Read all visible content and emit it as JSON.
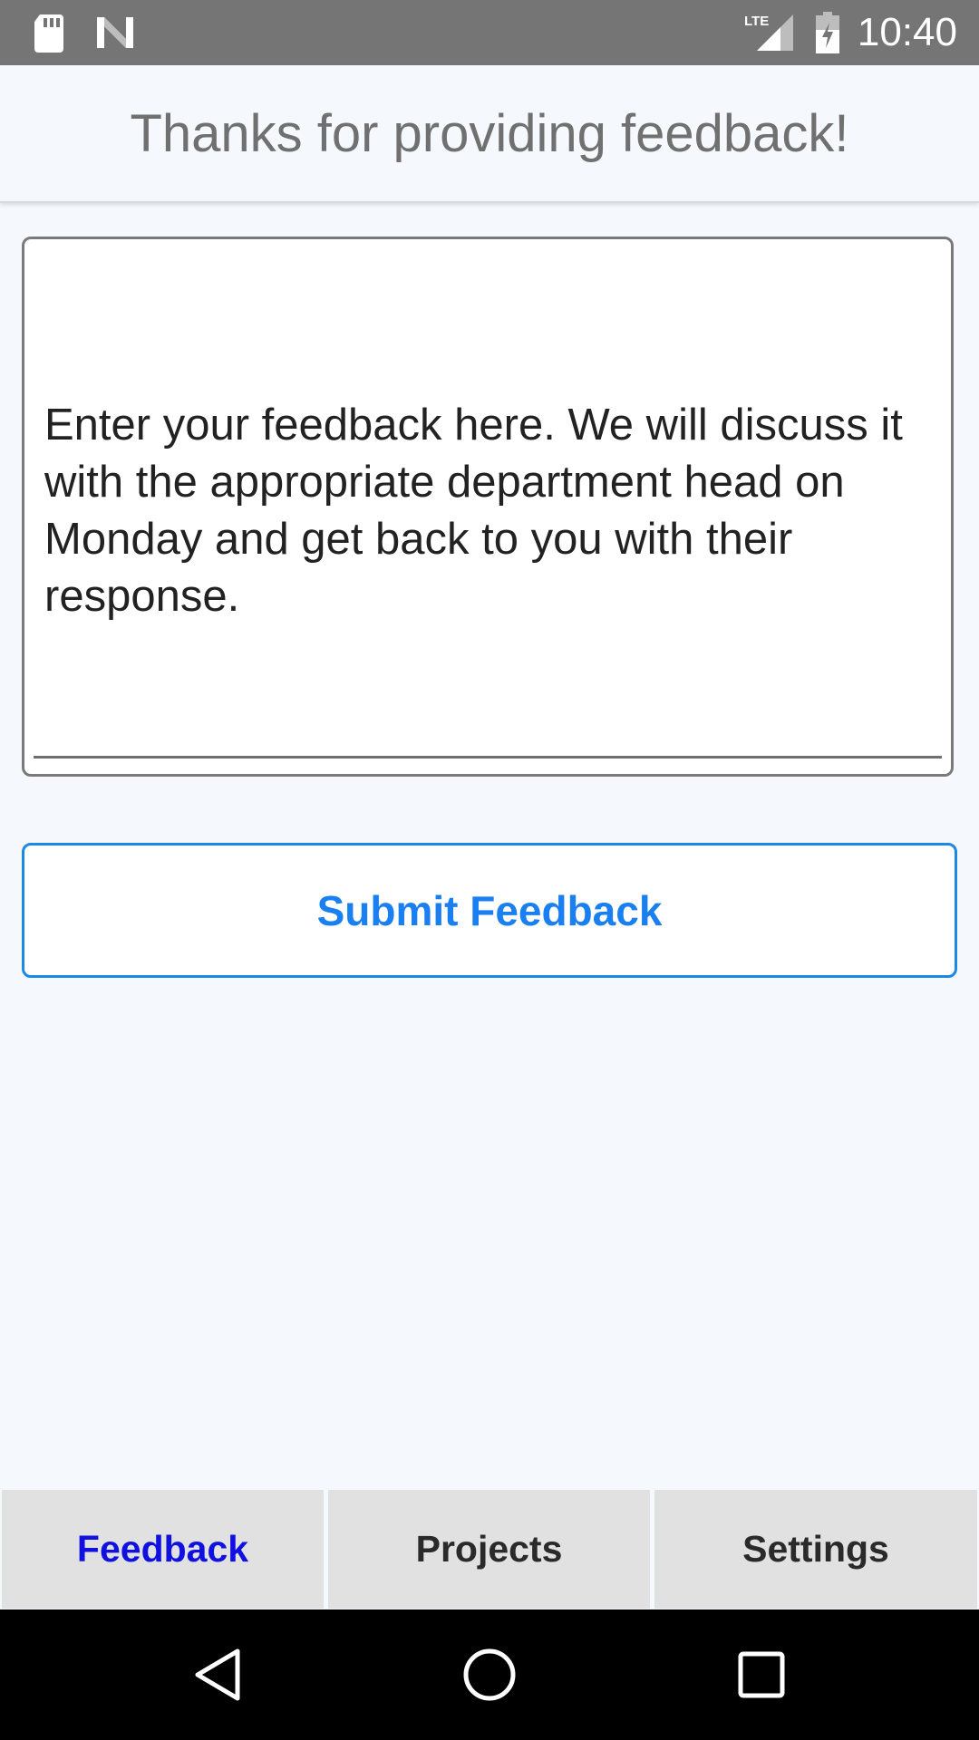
{
  "status_bar": {
    "time": "10:40",
    "network_label": "LTE",
    "icons": [
      "sd-card-icon",
      "n-logo-icon",
      "lte-signal-icon",
      "battery-charging-icon"
    ]
  },
  "header": {
    "title": "Thanks for providing feedback!"
  },
  "feedback": {
    "placeholder": "Enter your feedback here. We will discuss it with the appropriate department head on Monday and get back to you with their response."
  },
  "submit": {
    "label": "Submit Feedback"
  },
  "tabs": [
    {
      "label": "Feedback",
      "active": true
    },
    {
      "label": "Projects",
      "active": false
    },
    {
      "label": "Settings",
      "active": false
    }
  ],
  "colors": {
    "accent": "#1a7ff0",
    "active_tab": "#1010e0",
    "status_bar": "#757575",
    "background": "#f5f9fd"
  },
  "nav_bar": {
    "buttons": [
      "back-icon",
      "home-icon",
      "recents-icon"
    ]
  }
}
